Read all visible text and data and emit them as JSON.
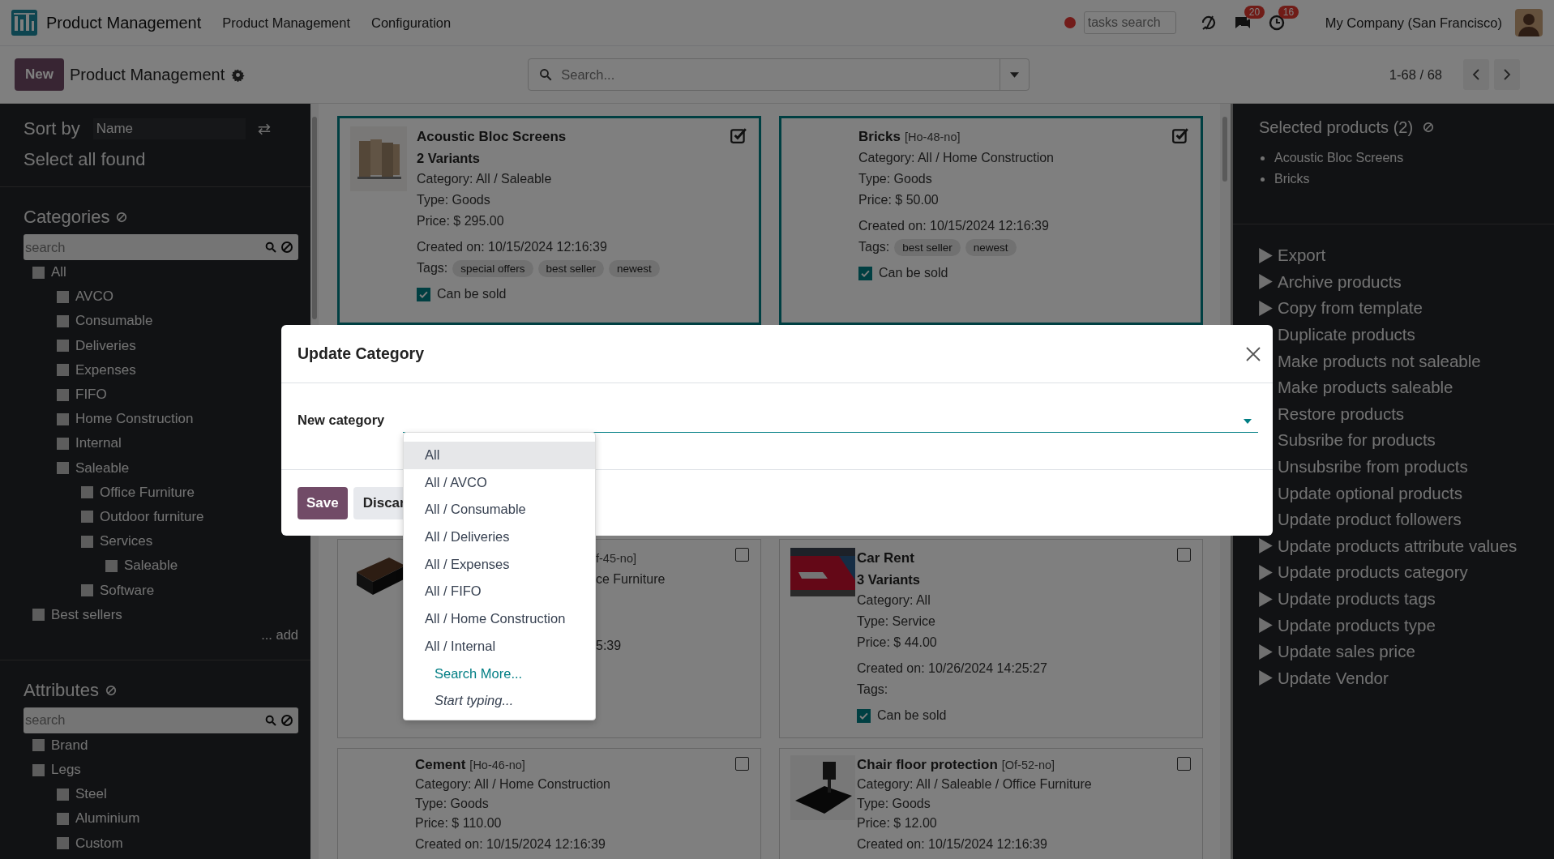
{
  "navbar": {
    "app_name": "Product Management",
    "menu": [
      "Product Management",
      "Configuration"
    ],
    "tasks_search": {
      "placeholder": "tasks search"
    },
    "messages_badge": "20",
    "activities_badge": "16",
    "company": "My Company (San Francisco)"
  },
  "control_panel": {
    "new_button": "New",
    "title": "Product Management",
    "search": {
      "placeholder": "Search..."
    },
    "pager": "1-68 / 68"
  },
  "sidebar": {
    "sort_label": "Sort by",
    "sort_value": "Name",
    "select_all": "Select all found",
    "categories": {
      "title": "Categories",
      "search_placeholder": "search",
      "add_link": "... add",
      "tree": [
        {
          "label": "All",
          "checked": false,
          "children": [
            {
              "label": "AVCO",
              "checked": false
            },
            {
              "label": "Consumable",
              "checked": false
            },
            {
              "label": "Deliveries",
              "checked": false
            },
            {
              "label": "Expenses",
              "checked": false
            },
            {
              "label": "FIFO",
              "checked": false
            },
            {
              "label": "Home Construction",
              "checked": false
            },
            {
              "label": "Internal",
              "checked": false
            },
            {
              "label": "Saleable",
              "checked": false,
              "children": [
                {
                  "label": "Office Furniture",
                  "checked": false
                },
                {
                  "label": "Outdoor furniture",
                  "checked": false
                },
                {
                  "label": "Services",
                  "checked": false,
                  "children": [
                    {
                      "label": "Saleable",
                      "checked": false
                    }
                  ]
                },
                {
                  "label": "Software",
                  "checked": false
                }
              ]
            }
          ]
        },
        {
          "label": "Best sellers",
          "checked": false
        }
      ]
    },
    "attributes": {
      "title": "Attributes",
      "search_placeholder": "search",
      "tree": [
        {
          "label": "Brand",
          "checked": false
        },
        {
          "label": "Legs",
          "checked": false,
          "children": [
            {
              "label": "Steel",
              "checked": false
            },
            {
              "label": "Aluminium",
              "checked": false
            },
            {
              "label": "Custom",
              "checked": false
            }
          ]
        }
      ]
    }
  },
  "cards": [
    {
      "kind": "full",
      "selected": true,
      "has_image": true,
      "name": "Acoustic Bloc Screens",
      "variants": "2 Variants",
      "details": [
        {
          "label": "Category:",
          "value": "All / Saleable"
        },
        {
          "label": "Type:",
          "value": "Goods"
        },
        {
          "label": "Price:",
          "value": "$ 295.00"
        }
      ],
      "created": {
        "label": "Created on:",
        "value": "10/15/2024 12:16:39"
      },
      "tags_label": "Tags:",
      "tags": [
        "special offers",
        "best seller",
        "newest"
      ],
      "sale": {
        "label": "Can be sold",
        "checked": true
      }
    },
    {
      "kind": "full",
      "selected": true,
      "has_image": false,
      "name": "Bricks",
      "code": "[Ho-48-no]",
      "details": [
        {
          "label": "Category:",
          "value": "All / Home Construction"
        },
        {
          "label": "Type:",
          "value": "Goods"
        },
        {
          "label": "Price:",
          "value": "$ 50.00"
        }
      ],
      "created": {
        "label": "Created on:",
        "value": "10/15/2024 12:16:39"
      },
      "tags_label": "Tags:",
      "tags": [
        "best seller",
        "newest"
      ],
      "sale": {
        "label": "Can be sold",
        "checked": true
      }
    },
    {
      "kind": "partial",
      "selected": false,
      "has_image": true,
      "code": "f-45-no]",
      "lines": [
        "ce Furniture",
        "5:39"
      ]
    },
    {
      "kind": "full",
      "selected": false,
      "has_image": true,
      "name": "Car Rent",
      "variants": "3 Variants",
      "details": [
        {
          "label": "Category:",
          "value": "All"
        },
        {
          "label": "Type:",
          "value": "Service"
        },
        {
          "label": "Price:",
          "value": "$ 44.00"
        }
      ],
      "created": {
        "label": "Created on:",
        "value": "10/26/2024 14:25:27"
      },
      "tags_label": "Tags:",
      "sale": {
        "label": "Can be sold",
        "checked": true
      }
    },
    {
      "kind": "full",
      "selected": false,
      "has_image": false,
      "name": "Cement",
      "code": "[Ho-46-no]",
      "details": [
        {
          "label": "Category:",
          "value": "All / Home Construction"
        },
        {
          "label": "Type:",
          "value": "Goods"
        },
        {
          "label": "Price:",
          "value": "$ 110.00"
        }
      ],
      "created": {
        "label": "Created on:",
        "value": "10/15/2024 12:16:39"
      }
    },
    {
      "kind": "full",
      "selected": false,
      "has_image": true,
      "name": "Chair floor protection",
      "code": "[Of-52-no]",
      "details": [
        {
          "label": "Category:",
          "value": "All / Saleable / Office Furniture"
        },
        {
          "label": "Type:",
          "value": "Goods"
        },
        {
          "label": "Price:",
          "value": "$ 12.00"
        }
      ],
      "created": {
        "label": "Created on:",
        "value": "10/15/2024 12:16:39"
      }
    }
  ],
  "selected_panel": {
    "title": "Selected products (2)",
    "items": [
      "Acoustic Bloc Screens",
      "Bricks"
    ]
  },
  "actions": [
    {
      "label": "Export",
      "kind": "arrow"
    },
    {
      "label": "Archive products",
      "kind": "arrow"
    },
    {
      "label": "Copy from template",
      "kind": "arrow"
    },
    {
      "label": "Duplicate products",
      "kind": "covered"
    },
    {
      "label": "Make products not saleable",
      "kind": "covered"
    },
    {
      "label": "Make products saleable",
      "kind": "covered"
    },
    {
      "label": "Restore products",
      "kind": "covered"
    },
    {
      "label": "Subsribe for products",
      "kind": "covered"
    },
    {
      "label": "Unsubsribe from products",
      "kind": "covered"
    },
    {
      "label": "Update optional products",
      "kind": "covered"
    },
    {
      "label": "Update product followers",
      "kind": "covered"
    },
    {
      "label": "Update products attribute values",
      "kind": "arrow"
    },
    {
      "label": "Update products category",
      "kind": "arrow"
    },
    {
      "label": "Update products tags",
      "kind": "arrow"
    },
    {
      "label": "Update products type",
      "kind": "arrow"
    },
    {
      "label": "Update sales price",
      "kind": "arrow"
    },
    {
      "label": "Update Vendor",
      "kind": "arrow"
    }
  ],
  "modal": {
    "title": "Update Category",
    "field_label": "New category",
    "save_button": "Save",
    "discard_button": "Discar",
    "options": [
      {
        "label": "All",
        "selected": true
      },
      {
        "label": "All / AVCO",
        "selected": false
      },
      {
        "label": "All / Consumable",
        "selected": false
      },
      {
        "label": "All / Deliveries",
        "selected": false
      },
      {
        "label": "All / Expenses",
        "selected": false
      },
      {
        "label": "All / FIFO",
        "selected": false
      },
      {
        "label": "All / Home Construction",
        "selected": false
      },
      {
        "label": "All / Internal",
        "selected": false
      }
    ],
    "search_more": "Search More...",
    "start_typing": "Start typing..."
  }
}
